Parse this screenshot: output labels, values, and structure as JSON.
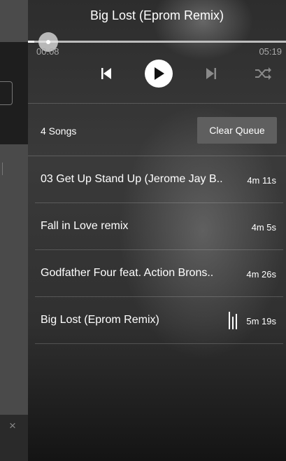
{
  "background_app": {
    "close_glyph": "×"
  },
  "player": {
    "now_playing_title": "Big Lost (Eprom Remix)",
    "current_time": "00:08",
    "total_time": "05:19",
    "progress_fraction": 0.025,
    "controls": {
      "previous_icon": "skip-previous-icon",
      "play_icon": "play-icon",
      "next_icon": "skip-next-icon",
      "shuffle_icon": "shuffle-icon"
    }
  },
  "queue": {
    "count_label": "4 Songs",
    "clear_label": "Clear Queue",
    "items": [
      {
        "title": "03 Get Up Stand Up (Jerome Jay B..",
        "duration": "4m 11s",
        "playing": false
      },
      {
        "title": "Fall in Love remix",
        "duration": "4m 5s",
        "playing": false
      },
      {
        "title": "Godfather Four feat. Action Brons..",
        "duration": "4m 26s",
        "playing": false
      },
      {
        "title": "Big Lost (Eprom Remix)",
        "duration": "5m 19s",
        "playing": true
      }
    ]
  },
  "colors": {
    "clear_button_bg": "#5f5f5f",
    "accent": "#ffffff",
    "time_text": "#aaaaaa"
  }
}
